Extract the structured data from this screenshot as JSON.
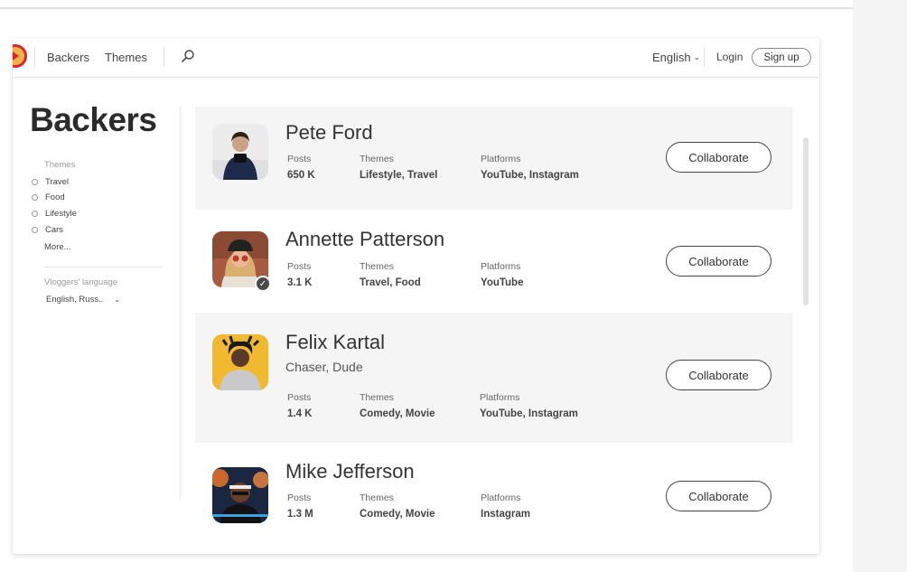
{
  "nav": {
    "links": [
      "Backers",
      "Themes"
    ],
    "language": "English",
    "login": "Login",
    "signup": "Sign up"
  },
  "page": {
    "title": "Backers"
  },
  "sidebar": {
    "themes_heading": "Themes",
    "themes": [
      "Travel",
      "Food",
      "Lifestyle",
      "Cars"
    ],
    "more": "More...",
    "language_heading": "Vloggers' language",
    "language_value": "English, Russ.."
  },
  "labels": {
    "posts": "Posts",
    "themes": "Themes",
    "platforms": "Platforms",
    "collaborate": "Collaborate"
  },
  "backers": [
    {
      "name": "Pete Ford",
      "posts": "650 K",
      "themes": "Lifestyle, Travel",
      "platforms": "YouTube, Instagram"
    },
    {
      "name": "Annette Patterson",
      "posts": "3.1 K",
      "themes": "Travel, Food",
      "platforms": "YouTube",
      "verified": true
    },
    {
      "name": "Felix Kartal",
      "tagline": "Chaser, Dude",
      "posts": "1.4 K",
      "themes": "Comedy, Movie",
      "platforms": "YouTube, Instagram"
    },
    {
      "name": "Mike Jefferson",
      "posts": "1.3 M",
      "themes": "Comedy, Movie",
      "platforms": "Instagram"
    }
  ],
  "colors": {
    "brand_red": "#d9262c",
    "brand_yellow": "#f2b24a",
    "card_shade": "#f5f5f5"
  }
}
